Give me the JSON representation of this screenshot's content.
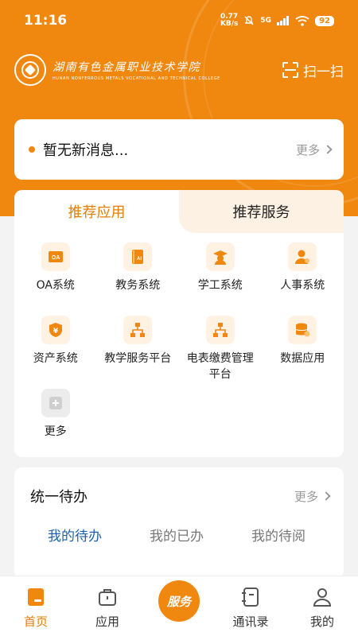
{
  "status": {
    "time": "11:16",
    "speed_value": "0.77",
    "speed_unit": "KB/s",
    "network": "5G",
    "battery": "92"
  },
  "header": {
    "school_name_cn": "湖南有色金属职业技术学院",
    "school_name_en": "HUNAN NONFERROUS METALS VOCATIONAL AND TECHNICAL COLLEGE",
    "scan_label": "扫一扫"
  },
  "notice": {
    "message": "暂无新消息...",
    "more_label": "更多"
  },
  "apps": {
    "tabs": [
      {
        "label": "推荐应用"
      },
      {
        "label": "推荐服务"
      }
    ],
    "items": [
      {
        "label": "OA系统",
        "icon": "oa-icon"
      },
      {
        "label": "教务系统",
        "icon": "book-ai-icon"
      },
      {
        "label": "学工系统",
        "icon": "student-icon"
      },
      {
        "label": "人事系统",
        "icon": "person-icon"
      },
      {
        "label": "资产系统",
        "icon": "yen-shield-icon"
      },
      {
        "label": "教学服务平台",
        "icon": "org-chart-icon"
      },
      {
        "label": "电表缴费管理平台",
        "icon": "org-chart-icon"
      },
      {
        "label": "数据应用",
        "icon": "database-icon"
      },
      {
        "label": "更多",
        "icon": "plus-icon"
      }
    ]
  },
  "todo": {
    "title": "统一待办",
    "more_label": "更多",
    "tabs": [
      {
        "label": "我的待办"
      },
      {
        "label": "我的已办"
      },
      {
        "label": "我的待阅"
      }
    ]
  },
  "bottom_nav": {
    "items": [
      {
        "label": "首页"
      },
      {
        "label": "应用"
      },
      {
        "label": "服务"
      },
      {
        "label": "通讯录"
      },
      {
        "label": "我的"
      }
    ]
  },
  "colors": {
    "brand": "#f0870f",
    "active_text": "#e57e06",
    "todo_active": "#1f5fae"
  }
}
